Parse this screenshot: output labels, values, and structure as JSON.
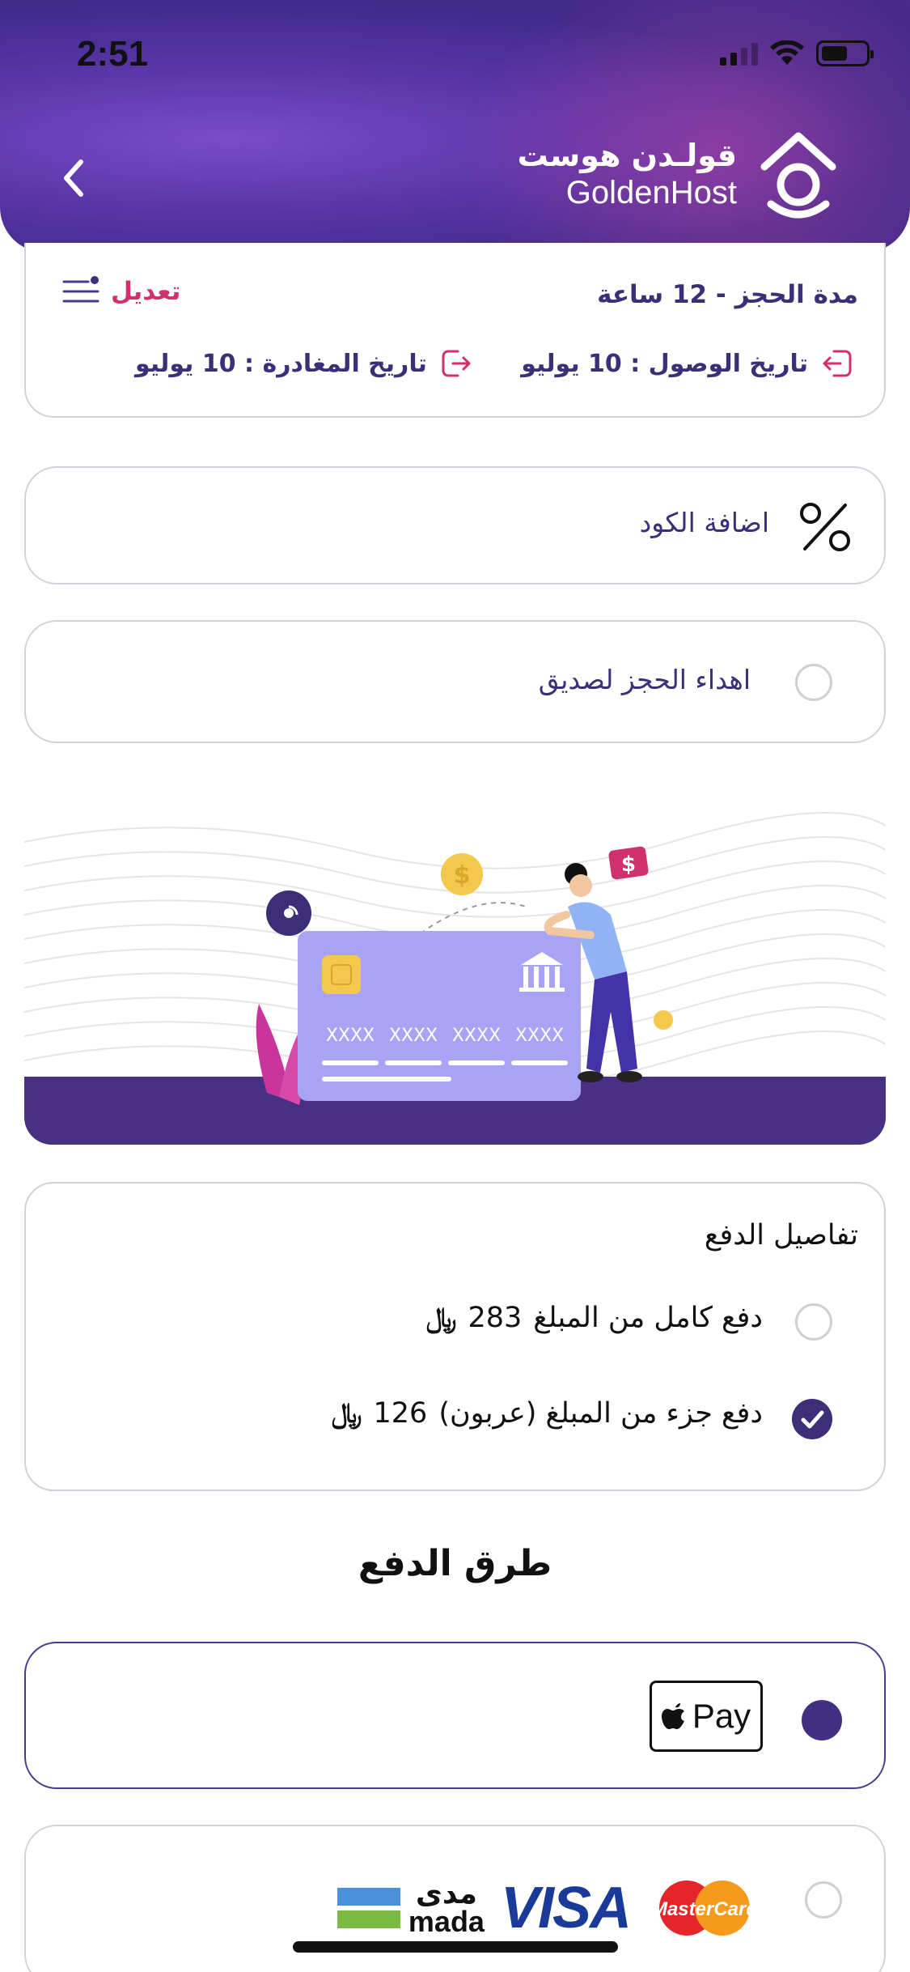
{
  "status_bar": {
    "time": "2:51"
  },
  "header": {
    "logo_ar": "قولـدن هوست",
    "logo_en": "GoldenHost",
    "back_icon": "chevron-left-icon"
  },
  "booking_summary": {
    "duration_label": "مدة الحجز -",
    "duration_value": "12 ساعة",
    "edit_label": "تعديل",
    "arrival_label": "تاريخ الوصول :",
    "arrival_value": "10 يوليو",
    "departure_label": "تاريخ المغادرة :",
    "departure_value": "10 يوليو"
  },
  "coupon": {
    "label": "اضافة الكود"
  },
  "gift": {
    "label": "اهداء الحجز لصديق",
    "checked": false
  },
  "illustration": {
    "card_numbers": [
      "XXXX",
      "XXXX",
      "XXXX",
      "XXXX"
    ],
    "coin_symbol": "$",
    "bubble_symbol": "$"
  },
  "payment_details": {
    "title": "تفاصيل الدفع",
    "options": [
      {
        "label": "دفع كامل من المبلغ",
        "amount": "283",
        "selected": false
      },
      {
        "label": "دفع جزء من المبلغ (عربون)",
        "amount": "126",
        "selected": true
      }
    ],
    "currency_symbol": "﷼"
  },
  "payment_methods": {
    "title": "طرق الدفع",
    "apple_pay": {
      "label": "Pay",
      "selected": true
    },
    "cards": {
      "mastercard": "MasterCard",
      "visa": "VISA",
      "mada_ar": "مدى",
      "mada_en": "mada",
      "selected": false
    }
  },
  "colors": {
    "primary": "#3d2e78",
    "accent_pink": "#d0306c",
    "card_purple": "#a9a3f5",
    "illustration_band": "#4a3083"
  }
}
